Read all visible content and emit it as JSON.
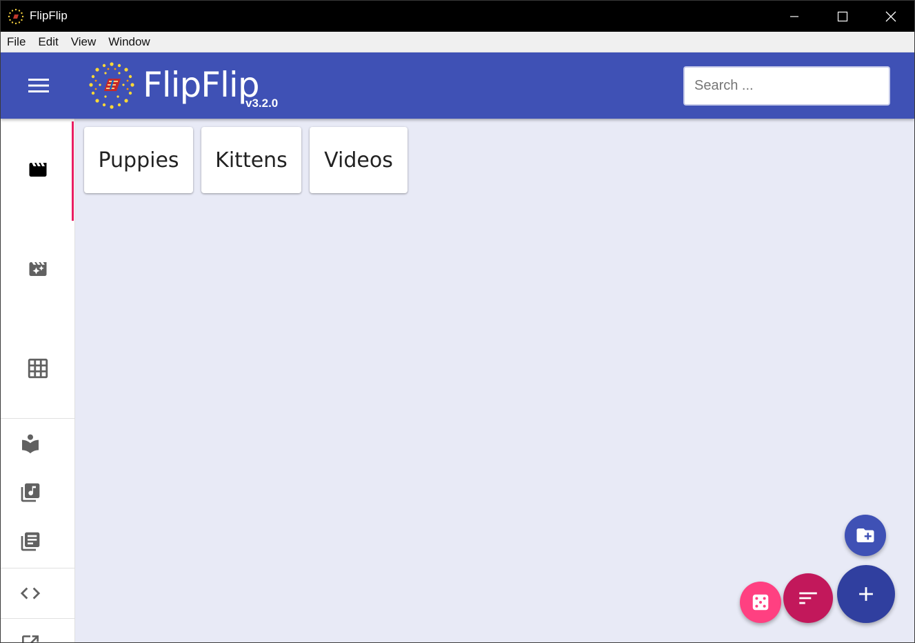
{
  "window": {
    "title": "FlipFlip",
    "controls": [
      "minimize-icon",
      "maximize-icon",
      "close-icon"
    ]
  },
  "menubar": {
    "items": [
      "File",
      "Edit",
      "View",
      "Window"
    ]
  },
  "appbar": {
    "name": "FlipFlip",
    "version": "v3.2.0",
    "search_placeholder": "Search ...",
    "color": "#3f51b5"
  },
  "sidebar": {
    "tabs": [
      {
        "icon": "movie-icon",
        "active": true
      },
      {
        "icon": "movie-filter-icon",
        "active": false
      },
      {
        "icon": "grid-icon",
        "active": false
      }
    ],
    "buttons": [
      {
        "icon": "library-reader-icon"
      },
      {
        "icon": "library-music-icon"
      },
      {
        "icon": "library-books-icon"
      },
      {
        "icon": "code-icon"
      },
      {
        "icon": "open-in-new-icon"
      }
    ],
    "active_indicator_color": "#e91e63"
  },
  "scenes": [
    "Puppies",
    "Kittens",
    "Videos"
  ],
  "fabs": [
    {
      "icon": "create-new-folder-icon",
      "color": "#3f51b5"
    },
    {
      "icon": "add-icon",
      "color": "#303f9f"
    },
    {
      "icon": "sort-icon",
      "color": "#c2185b"
    },
    {
      "icon": "dice-icon",
      "color": "#ff4081"
    }
  ]
}
